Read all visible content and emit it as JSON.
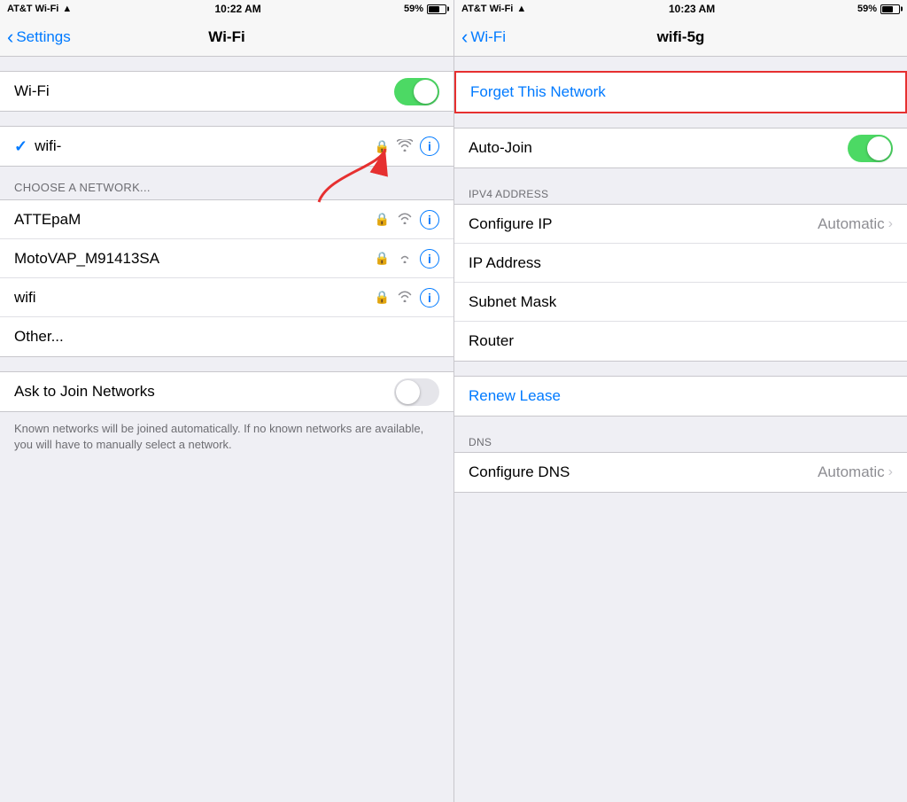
{
  "left_panel": {
    "status_bar": {
      "carrier": "AT&T Wi-Fi",
      "time": "10:22 AM",
      "battery": "59%"
    },
    "nav": {
      "back_label": "Settings",
      "title": "Wi-Fi"
    },
    "wifi_row": {
      "label": "Wi-Fi"
    },
    "connected_network": {
      "name": "wifi-"
    },
    "section_header": "CHOOSE A NETWORK...",
    "networks": [
      {
        "name": "ATTEpaM"
      },
      {
        "name": "MotoVAP_M91413SA"
      },
      {
        "name": "wifi"
      },
      {
        "name": "Other..."
      }
    ],
    "ask_join": {
      "label": "Ask to Join Networks"
    },
    "footer_text": "Known networks will be joined automatically. If no known networks are available, you will have to manually select a network."
  },
  "right_panel": {
    "status_bar": {
      "carrier": "AT&T Wi-Fi",
      "time": "10:23 AM",
      "battery": "59%"
    },
    "nav": {
      "back_label": "Wi-Fi",
      "title": "wifi-5g"
    },
    "forget_network": "Forget This Network",
    "auto_join": {
      "label": "Auto-Join"
    },
    "ipv4_section_label": "IPV4 ADDRESS",
    "ipv4_rows": [
      {
        "label": "Configure IP",
        "value": "Automatic"
      },
      {
        "label": "IP Address",
        "value": ""
      },
      {
        "label": "Subnet Mask",
        "value": ""
      },
      {
        "label": "Router",
        "value": ""
      }
    ],
    "renew_lease": "Renew Lease",
    "dns_section_label": "DNS",
    "dns_rows": [
      {
        "label": "Configure DNS",
        "value": "Automatic"
      }
    ]
  }
}
